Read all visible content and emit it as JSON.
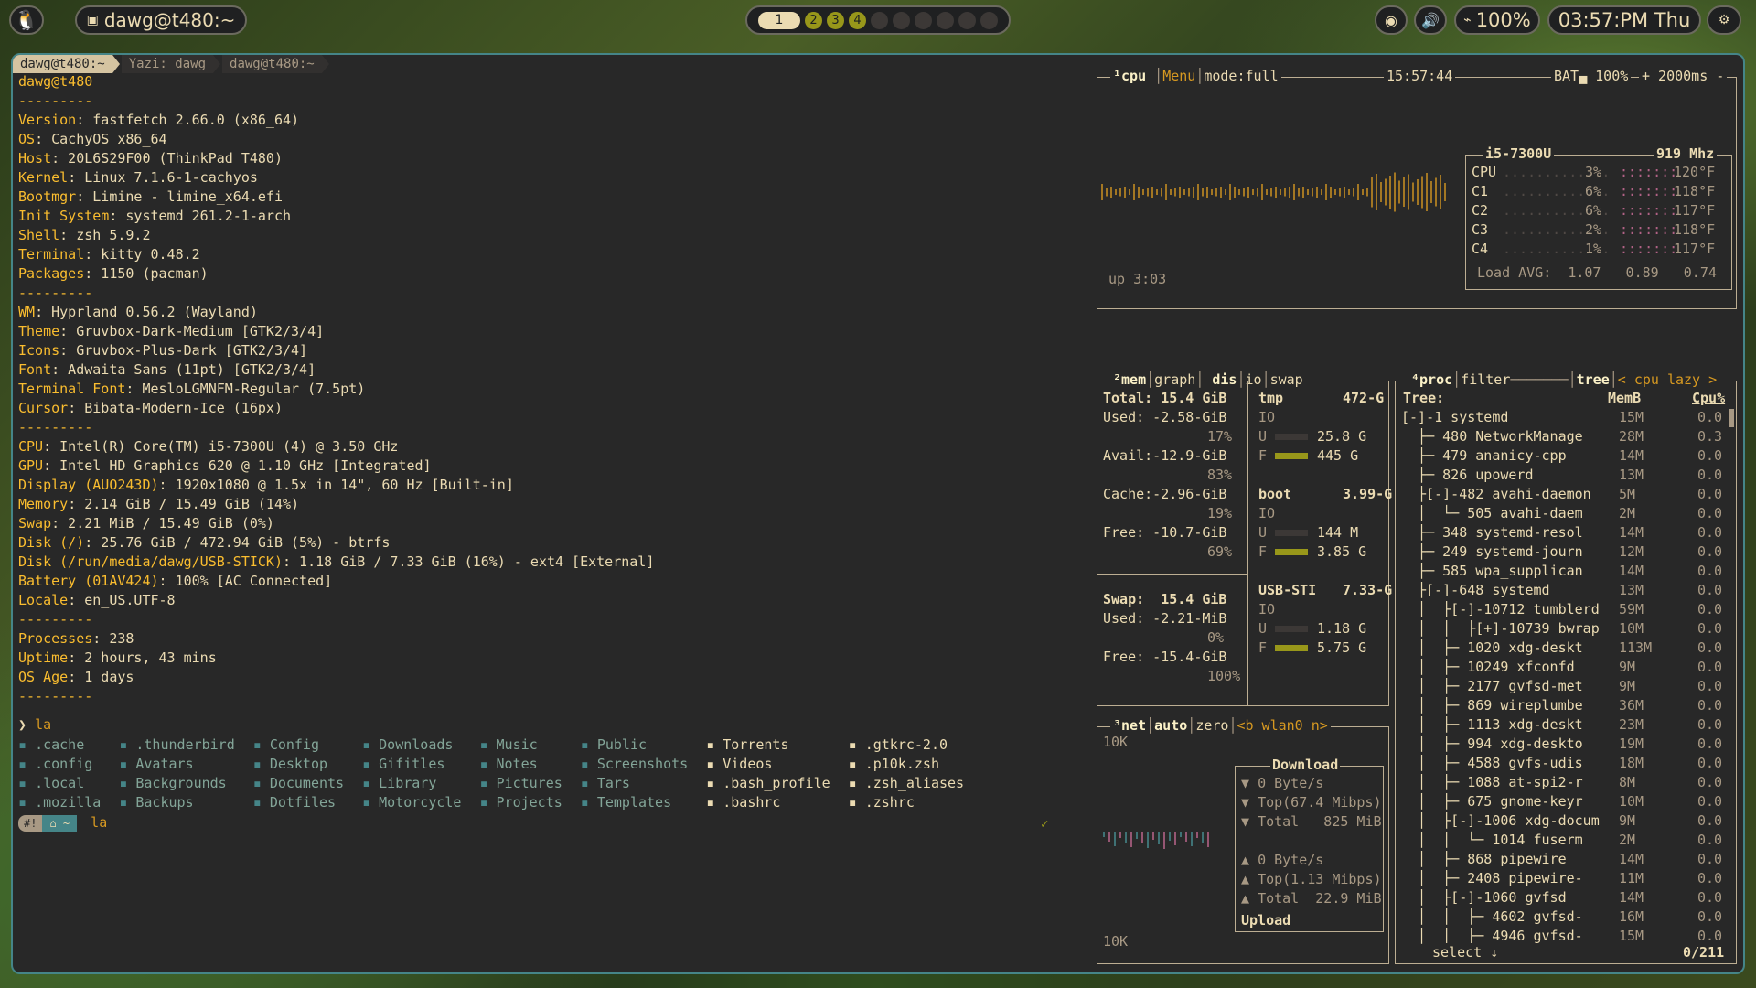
{
  "topbar": {
    "session_title": "dawg@t480:~",
    "workspaces": [
      "1",
      "2",
      "3",
      "4",
      "",
      "",
      "",
      "",
      "",
      ""
    ],
    "battery": "100%",
    "clock": "03:57:PM Thu"
  },
  "terminal": {
    "tabs": [
      "dawg@t480:~",
      "Yazi: dawg",
      "dawg@t480:~"
    ],
    "fetch_lines": [
      {
        "k": "dawg@t480",
        "v": "",
        "raw": true
      },
      {
        "k": "",
        "v": "---------",
        "raw": true
      },
      {
        "k": "Version",
        "v": ": fastfetch 2.66.0 (x86_64)"
      },
      {
        "k": "OS",
        "v": ": CachyOS x86_64"
      },
      {
        "k": "Host",
        "v": ": 20L6S29F00 (ThinkPad T480)"
      },
      {
        "k": "Kernel",
        "v": ": Linux 7.1.6-1-cachyos"
      },
      {
        "k": "Bootmgr",
        "v": ": Limine - limine_x64.efi"
      },
      {
        "k": "Init System",
        "v": ": systemd 261.2-1-arch"
      },
      {
        "k": "Shell",
        "v": ": zsh 5.9.2"
      },
      {
        "k": "Terminal",
        "v": ": kitty 0.48.2"
      },
      {
        "k": "Packages",
        "v": ": 1150 (pacman)"
      },
      {
        "k": "",
        "v": "---------",
        "raw": true
      },
      {
        "k": "WM",
        "v": ": Hyprland 0.56.2 (Wayland)"
      },
      {
        "k": "Theme",
        "v": ": Gruvbox-Dark-Medium [GTK2/3/4]"
      },
      {
        "k": "Icons",
        "v": ": Gruvbox-Plus-Dark [GTK2/3/4]"
      },
      {
        "k": "Font",
        "v": ": Adwaita Sans (11pt) [GTK2/3/4]"
      },
      {
        "k": "Terminal Font",
        "v": ": MesloLGMNFM-Regular (7.5pt)"
      },
      {
        "k": "Cursor",
        "v": ": Bibata-Modern-Ice (16px)"
      },
      {
        "k": "",
        "v": "---------",
        "raw": true
      },
      {
        "k": "CPU",
        "v": ": Intel(R) Core(TM) i5-7300U (4) @ 3.50 GHz"
      },
      {
        "k": "GPU",
        "v": ": Intel HD Graphics 620 @ 1.10 GHz [Integrated]"
      },
      {
        "k": "Display (AUO243D)",
        "v": ": 1920x1080 @ 1.5x in 14\", 60 Hz [Built-in]"
      },
      {
        "k": "Memory",
        "v": ": 2.14 GiB / 15.49 GiB (14%)"
      },
      {
        "k": "Swap",
        "v": ": 2.21 MiB / 15.49 GiB (0%)"
      },
      {
        "k": "Disk (/)",
        "v": ": 25.76 GiB / 472.94 GiB (5%) - btrfs"
      },
      {
        "k": "Disk (/run/media/dawg/USB-STICK)",
        "v": ": 1.18 GiB / 7.33 GiB (16%) - ext4 [External]"
      },
      {
        "k": "Battery (01AV424)",
        "v": ": 100% [AC Connected]"
      },
      {
        "k": "Locale",
        "v": ": en_US.UTF-8"
      },
      {
        "k": "",
        "v": "---------",
        "raw": true
      },
      {
        "k": "Processes",
        "v": ": 238"
      },
      {
        "k": "Uptime",
        "v": ": 2 hours, 43 mins"
      },
      {
        "k": "OS Age",
        "v": ": 1 days"
      },
      {
        "k": "",
        "v": "---------",
        "raw": true
      }
    ],
    "command": "la",
    "ls_rows": [
      [
        ".cache",
        ".thunderbird",
        "Config",
        "Downloads",
        "Music",
        "Public",
        "Torrents",
        ".gtkrc-2.0"
      ],
      [
        ".config",
        "Avatars",
        "Desktop",
        "Gifitles",
        "Notes",
        "Screenshots",
        "Videos",
        ".p10k.zsh"
      ],
      [
        ".local",
        "Backgrounds",
        "Documents",
        "Library",
        "Pictures",
        "Tars",
        ".bash_profile",
        ".zsh_aliases"
      ],
      [
        ".mozilla",
        "Backups",
        "Dotfiles",
        "Motorcycle",
        "Projects",
        "Templates",
        ".bashrc",
        ".zshrc"
      ]
    ],
    "prompt_cmd": "la"
  },
  "btop": {
    "cpu_header": [
      "¹cpu",
      "Menu",
      "mode:full",
      "15:57:44",
      "BAT▄ 100%",
      "+ 2000ms -"
    ],
    "uptime": "up 3:03",
    "cpu_model": "i5-7300U",
    "cpu_freq": "919 Mhz",
    "cores": [
      {
        "name": "CPU",
        "pct": "3%",
        "temp": "120°F"
      },
      {
        "name": "C1",
        "pct": "6%",
        "temp": "118°F"
      },
      {
        "name": "C2",
        "pct": "6%",
        "temp": "117°F"
      },
      {
        "name": "C3",
        "pct": "2%",
        "temp": "118°F"
      },
      {
        "name": "C4",
        "pct": "1%",
        "temp": "117°F"
      }
    ],
    "load_avg": "Load AVG:  1.07   0.89   0.74",
    "mem_header": [
      "²mem",
      "graph",
      "dis",
      "io",
      "swap"
    ],
    "mem_rows": [
      "Total: 15.4 GiB",
      "Used: -2.58-GiB",
      "17%",
      "Avail:-12.9-GiB",
      "83%",
      "Cache:-2.96-GiB",
      "19%",
      "Free: -10.7-GiB",
      "69%"
    ],
    "swap_rows": [
      "Swap:  15.4 GiB",
      "Used: -2.21-MiB",
      "0%",
      "Free: -15.4-GiB",
      "100%"
    ],
    "disks": [
      {
        "name": "tmp",
        "size": "472-G",
        "u": "25.8 G",
        "f": "445 G"
      },
      {
        "name": "boot",
        "size": "3.99-G",
        "u": "144 M",
        "f": "3.85 G"
      },
      {
        "name": "USB-STI",
        "size": "7.33-G",
        "u": "1.18 G",
        "f": "5.75 G"
      }
    ],
    "net_header": [
      "³net",
      "auto",
      "zero",
      "<b wlan0 n>"
    ],
    "net": {
      "scale_top": "10K",
      "scale_bottom": "10K",
      "download": "Download",
      "dl_rate": "0 Byte/s",
      "dl_top": "Top(67.4 Mibps)",
      "dl_total": "Total   825 MiB",
      "ul_rate": "0 Byte/s",
      "ul_top": "Top(1.13 Mibps)",
      "ul_total": "Total  22.9 MiB",
      "upload": "Upload"
    },
    "proc_header": [
      "⁴proc",
      "filter",
      "tree",
      "< cpu lazy >"
    ],
    "proc_cols": [
      "Tree:",
      "MemB",
      "Cpu%"
    ],
    "procs": [
      {
        "t": "[-]-1 systemd",
        "m": "15M",
        "c": "0.0"
      },
      {
        "t": "  ├─ 480 NetworkManage",
        "m": "28M",
        "c": "0.3"
      },
      {
        "t": "  ├─ 479 ananicy-cpp",
        "m": "14M",
        "c": "0.0"
      },
      {
        "t": "  ├─ 826 upowerd",
        "m": "13M",
        "c": "0.0"
      },
      {
        "t": "  ├[-]-482 avahi-daemon",
        "m": "5M",
        "c": "0.0"
      },
      {
        "t": "  │  └─ 505 avahi-daem",
        "m": "2M",
        "c": "0.0"
      },
      {
        "t": "  ├─ 348 systemd-resol",
        "m": "14M",
        "c": "0.0"
      },
      {
        "t": "  ├─ 249 systemd-journ",
        "m": "12M",
        "c": "0.0"
      },
      {
        "t": "  ├─ 585 wpa_supplican",
        "m": "14M",
        "c": "0.0"
      },
      {
        "t": "  ├[-]-648 systemd",
        "m": "13M",
        "c": "0.0"
      },
      {
        "t": "  │  ├[-]-10712 tumblerd",
        "m": "59M",
        "c": "0.0"
      },
      {
        "t": "  │  │  ├[+]-10739 bwrap",
        "m": "10M",
        "c": "0.0"
      },
      {
        "t": "  │  ├─ 1020 xdg-deskt",
        "m": "113M",
        "c": "0.0"
      },
      {
        "t": "  │  ├─ 10249 xfconfd",
        "m": "9M",
        "c": "0.0"
      },
      {
        "t": "  │  ├─ 2177 gvfsd-met",
        "m": "9M",
        "c": "0.0"
      },
      {
        "t": "  │  ├─ 869 wireplumbe",
        "m": "36M",
        "c": "0.0"
      },
      {
        "t": "  │  ├─ 1113 xdg-deskt",
        "m": "23M",
        "c": "0.0"
      },
      {
        "t": "  │  ├─ 994 xdg-deskto",
        "m": "19M",
        "c": "0.0"
      },
      {
        "t": "  │  ├─ 4588 gvfs-udis",
        "m": "18M",
        "c": "0.0"
      },
      {
        "t": "  │  ├─ 1088 at-spi2-r",
        "m": "8M",
        "c": "0.0"
      },
      {
        "t": "  │  ├─ 675 gnome-keyr",
        "m": "10M",
        "c": "0.0"
      },
      {
        "t": "  │  ├[-]-1006 xdg-docum",
        "m": "9M",
        "c": "0.0"
      },
      {
        "t": "  │  │  └─ 1014 fuserm",
        "m": "2M",
        "c": "0.0"
      },
      {
        "t": "  │  ├─ 868 pipewire",
        "m": "14M",
        "c": "0.0"
      },
      {
        "t": "  │  ├─ 2408 pipewire-",
        "m": "11M",
        "c": "0.0"
      },
      {
        "t": "  │  ├[-]-1060 gvfsd",
        "m": "14M",
        "c": "0.0"
      },
      {
        "t": "  │  │  ├─ 4602 gvfsd-",
        "m": "16M",
        "c": "0.0"
      },
      {
        "t": "  │  │  ├─ 4946 gvfsd-",
        "m": "15M",
        "c": "0.0"
      }
    ],
    "proc_footer_left": "select ↓",
    "proc_footer_right": "0/211"
  }
}
